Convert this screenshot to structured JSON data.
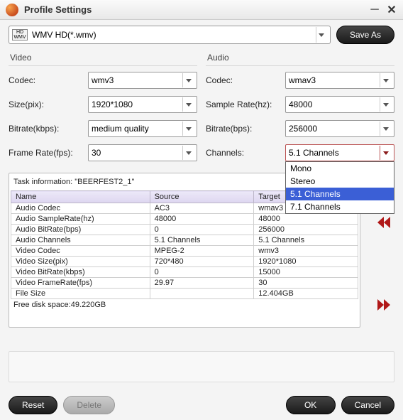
{
  "window": {
    "title": "Profile Settings"
  },
  "profile": {
    "badge": "HD WMV",
    "value": "WMV HD(*.wmv)",
    "saveAs": "Save As"
  },
  "video": {
    "title": "Video",
    "codec": {
      "label": "Codec:",
      "value": "wmv3"
    },
    "size": {
      "label": "Size(pix):",
      "value": "1920*1080"
    },
    "bitrate": {
      "label": "Bitrate(kbps):",
      "value": "medium quality"
    },
    "framerate": {
      "label": "Frame Rate(fps):",
      "value": "30"
    }
  },
  "audio": {
    "title": "Audio",
    "codec": {
      "label": "Codec:",
      "value": "wmav3"
    },
    "samplerate": {
      "label": "Sample Rate(hz):",
      "value": "48000"
    },
    "bitrate": {
      "label": "Bitrate(bps):",
      "value": "256000"
    },
    "channels": {
      "label": "Channels:",
      "value": "5.1 Channels",
      "opt0": "Mono",
      "opt1": "Stereo",
      "opt2": "5.1 Channels",
      "opt3": "7.1 Channels"
    }
  },
  "task": {
    "title": "Task information: \"BEERFEST2_1\"",
    "cols": {
      "c0": "Name",
      "c1": "Source",
      "c2": "Target"
    },
    "rows": {
      "r0": {
        "n": "Audio Codec",
        "s": "AC3",
        "t": "wmav3"
      },
      "r1": {
        "n": "Audio SampleRate(hz)",
        "s": "48000",
        "t": "48000"
      },
      "r2": {
        "n": "Audio BitRate(bps)",
        "s": "0",
        "t": "256000"
      },
      "r3": {
        "n": "Audio Channels",
        "s": "5.1 Channels",
        "t": "5.1 Channels"
      },
      "r4": {
        "n": "Video Codec",
        "s": "MPEG-2",
        "t": "wmv3"
      },
      "r5": {
        "n": "Video Size(pix)",
        "s": "720*480",
        "t": "1920*1080"
      },
      "r6": {
        "n": "Video BitRate(kbps)",
        "s": "0",
        "t": "15000"
      },
      "r7": {
        "n": "Video FrameRate(fps)",
        "s": "29.97",
        "t": "30"
      },
      "r8": {
        "n": "File Size",
        "s": "",
        "t": "12.404GB"
      }
    },
    "free": "Free disk space:49.220GB"
  },
  "footer": {
    "reset": "Reset",
    "delete": "Delete",
    "ok": "OK",
    "cancel": "Cancel"
  }
}
